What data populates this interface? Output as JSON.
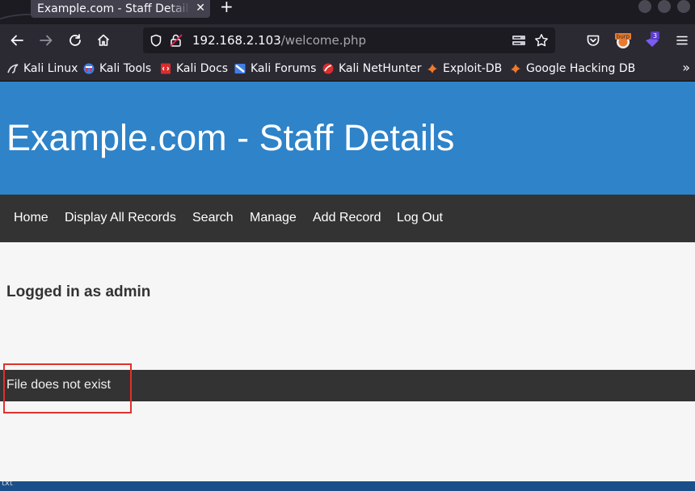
{
  "browser": {
    "tab": {
      "title": "Example.com - Staff Details - Mozilla Firefox"
    },
    "url": {
      "host": "192.168.2.103",
      "path": "/welcome.php"
    },
    "extensions": {
      "burp_label": "burp",
      "badge_count": "3"
    },
    "bookmarks": [
      {
        "label": "Kali Linux",
        "icon": "kali-dragon-icon"
      },
      {
        "label": "Kali Tools",
        "icon": "kali-tools-icon"
      },
      {
        "label": "Kali Docs",
        "icon": "kali-docs-icon"
      },
      {
        "label": "Kali Forums",
        "icon": "kali-forums-icon"
      },
      {
        "label": "Kali NetHunter",
        "icon": "kali-nethunter-icon"
      },
      {
        "label": "Exploit-DB",
        "icon": "exploit-db-icon"
      },
      {
        "label": "Google Hacking DB",
        "icon": "google-hacking-db-icon"
      }
    ]
  },
  "site": {
    "title": "Example.com - Staff Details",
    "nav": [
      "Home",
      "Display All Records",
      "Search",
      "Manage",
      "Add Record",
      "Log Out"
    ],
    "logged_in": "Logged in as admin",
    "message": "File does not exist"
  },
  "taskbar": {
    "text": "txt"
  },
  "colors": {
    "header_blue": "#2e83c9",
    "nav_dark": "#333333",
    "page_bg": "#f6f6f6",
    "highlight_red": "#e0312c"
  }
}
